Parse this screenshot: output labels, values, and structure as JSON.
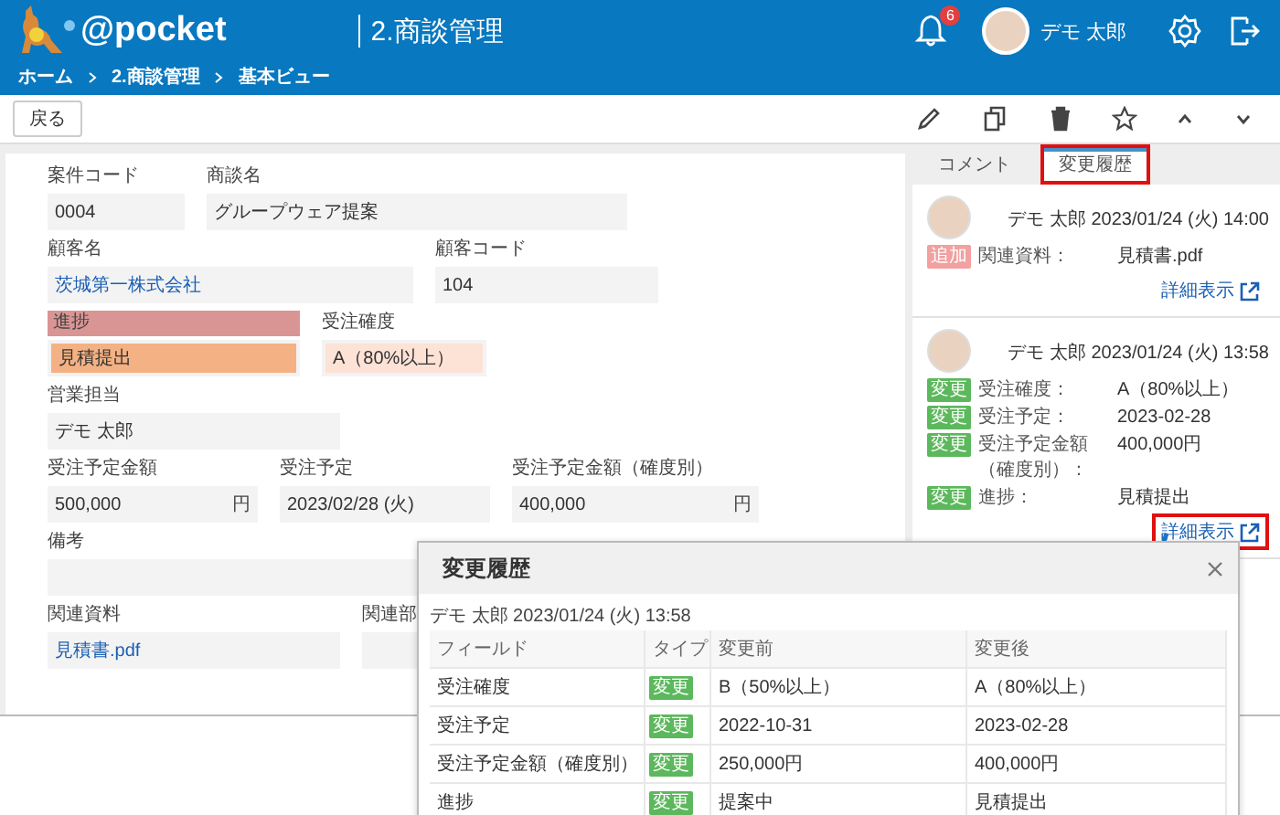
{
  "header": {
    "logo_text": "@pocket",
    "title": "2.商談管理",
    "notification_count": "6",
    "user_name": "デモ 太郎"
  },
  "breadcrumb": [
    "ホーム",
    "2.商談管理",
    "基本ビュー"
  ],
  "toolbar": {
    "back_label": "戻る"
  },
  "form_rows": [
    [
      {
        "label": "案件コード",
        "value": "0004"
      },
      {
        "label": "商談名",
        "value": "グループウェア提案"
      }
    ],
    [
      {
        "label": "顧客名",
        "value": "茨城第一株式会社",
        "link": true
      },
      {
        "label": "顧客コード",
        "value": "104"
      }
    ],
    [
      {
        "label": "進捗",
        "value": "見積提出",
        "kind": "status",
        "color": "#f4b183"
      },
      {
        "label": "受注確度",
        "value": "A（80%以上）",
        "color": "#fde2d6"
      }
    ],
    [
      {
        "label": "営業担当",
        "value": "デモ 太郎"
      }
    ],
    [
      {
        "label": "受注予定金額",
        "value": "500,000",
        "unit": "円"
      },
      {
        "label": "受注予定",
        "value": "2023/02/28 (火)"
      },
      {
        "label": "受注予定金額（確度別）",
        "value": "400,000",
        "unit": "円"
      }
    ],
    [
      {
        "label": "備考"
      }
    ],
    [
      {
        "label": "関連資料",
        "value": "見積書.pdf",
        "link": true
      },
      {
        "label": "関連部"
      }
    ]
  ],
  "side_panel": {
    "tabs": [
      {
        "label": "コメント",
        "selected": false,
        "highlighted": false
      },
      {
        "label": "変更履歴",
        "selected": true,
        "highlighted": true
      }
    ],
    "entries": [
      {
        "byline": "デモ 太郎 2023/01/24 (火) 14:00",
        "link_label": "詳細表示",
        "link_highlighted": false,
        "changes": [
          {
            "kind": "add",
            "badge": "追加",
            "field": "関連資料：",
            "value": "見積書.pdf"
          }
        ]
      },
      {
        "byline": "デモ 太郎 2023/01/24 (火) 13:58",
        "link_label": "詳細表示",
        "link_highlighted": true,
        "changes": [
          {
            "kind": "change",
            "badge": "変更",
            "field": "受注確度：",
            "value": "A（80%以上）"
          },
          {
            "kind": "change",
            "badge": "変更",
            "field": "受注予定：",
            "value": "2023-02-28"
          },
          {
            "kind": "change",
            "badge": "変更",
            "field": "受注予定金額（確度別）：",
            "value": "400,000円"
          },
          {
            "kind": "change",
            "badge": "変更",
            "field": "進捗：",
            "value": "見積提出"
          }
        ]
      }
    ]
  },
  "dialog": {
    "title": "変更履歴",
    "subtitle": "デモ 太郎 2023/01/24 (火) 13:58",
    "columns": [
      "フィールド",
      "タイプ",
      "変更前",
      "変更後"
    ],
    "rows": [
      {
        "field": "受注確度",
        "kind": "change",
        "type": "変更",
        "before": "B（50%以上）",
        "after": "A（80%以上）"
      },
      {
        "field": "受注予定",
        "kind": "change",
        "type": "変更",
        "before": "2022-10-31",
        "after": "2023-02-28"
      },
      {
        "field": "受注予定金額（確度別）",
        "kind": "change",
        "type": "変更",
        "before": "250,000円",
        "after": "400,000円"
      },
      {
        "field": "進捗",
        "kind": "change",
        "type": "変更",
        "before": "提案中",
        "after": "見積提出"
      }
    ]
  }
}
